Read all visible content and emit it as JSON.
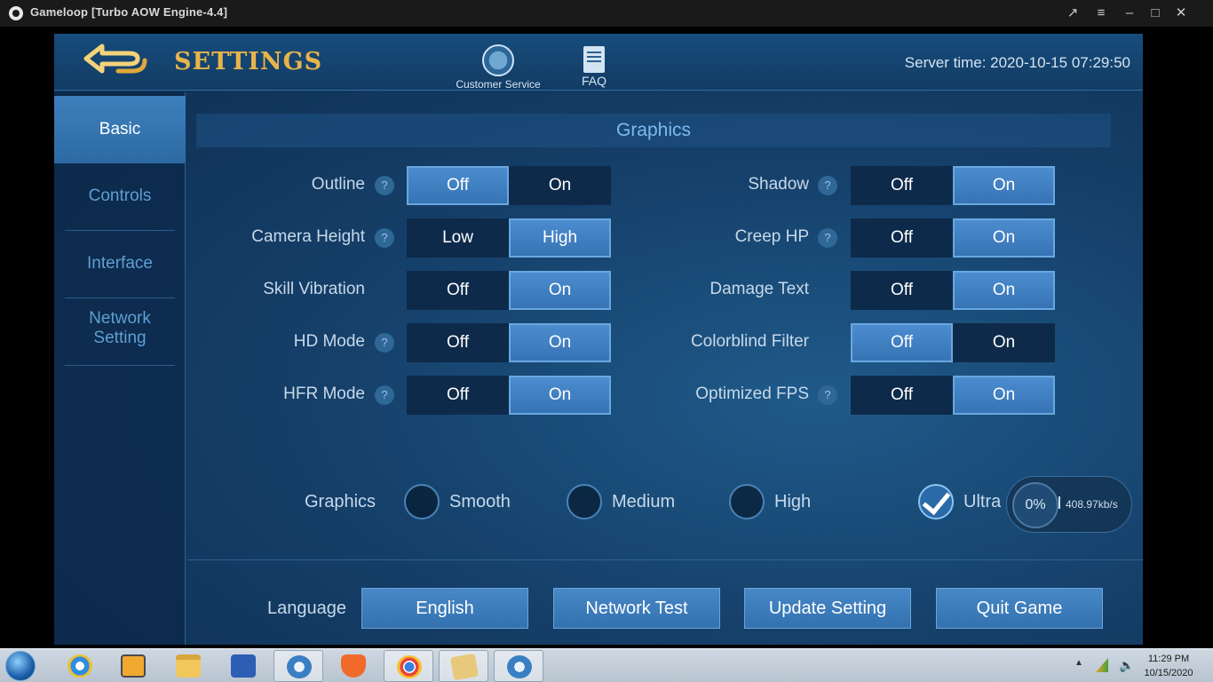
{
  "window": {
    "title": "Gameloop  [Turbo AOW Engine-4.4]"
  },
  "header": {
    "title": "SETTINGS",
    "customer_service": "Customer Service",
    "faq": "FAQ",
    "server_time": "Server time: 2020-10-15 07:29:50"
  },
  "sidebar": {
    "items": [
      {
        "label": "Basic",
        "active": true
      },
      {
        "label": "Controls",
        "active": false
      },
      {
        "label": "Interface",
        "active": false
      },
      {
        "label": "Network Setting",
        "active": false
      }
    ]
  },
  "graphics": {
    "section_title": "Graphics",
    "left": [
      {
        "label": "Outline",
        "help": true,
        "options": [
          "Off",
          "On"
        ],
        "selected": "Off"
      },
      {
        "label": "Camera Height",
        "help": true,
        "options": [
          "Low",
          "High"
        ],
        "selected": "High"
      },
      {
        "label": "Skill Vibration",
        "help": false,
        "options": [
          "Off",
          "On"
        ],
        "selected": "On"
      },
      {
        "label": "HD Mode",
        "help": true,
        "options": [
          "Off",
          "On"
        ],
        "selected": "On"
      },
      {
        "label": "HFR Mode",
        "help": true,
        "options": [
          "Off",
          "On"
        ],
        "selected": "On"
      }
    ],
    "right": [
      {
        "label": "Shadow",
        "help": true,
        "options": [
          "Off",
          "On"
        ],
        "selected": "On"
      },
      {
        "label": "Creep HP",
        "help": true,
        "options": [
          "Off",
          "On"
        ],
        "selected": "On"
      },
      {
        "label": "Damage Text",
        "help": false,
        "options": [
          "Off",
          "On"
        ],
        "selected": "On"
      },
      {
        "label": "Colorblind Filter",
        "help": false,
        "options": [
          "Off",
          "On"
        ],
        "selected": "Off"
      },
      {
        "label": "Optimized FPS",
        "help": true,
        "options": [
          "Off",
          "On"
        ],
        "selected": "On"
      }
    ],
    "quality": {
      "label": "Graphics",
      "options": [
        "Smooth",
        "Medium",
        "High",
        "Ultra"
      ],
      "selected": "Ultra"
    }
  },
  "network_badge": {
    "percent": "0%",
    "speed": "408.97kb/s"
  },
  "footer": {
    "language_label": "Language",
    "language_value": "English",
    "network_test": "Network Test",
    "update_setting": "Update Setting",
    "quit_game": "Quit Game"
  },
  "taskbar": {
    "time": "11:29 PM",
    "date": "10/15/2020",
    "apps": [
      "internet-explorer",
      "media-player",
      "file-explorer",
      "word",
      "gameloop",
      "brave",
      "chrome",
      "folder",
      "gameloop"
    ]
  },
  "help_glyph": "?",
  "colors": {
    "accent_gold": "#e8b44a",
    "selected_blue": "#3d7ec2",
    "panel_bg": "#15406a"
  }
}
